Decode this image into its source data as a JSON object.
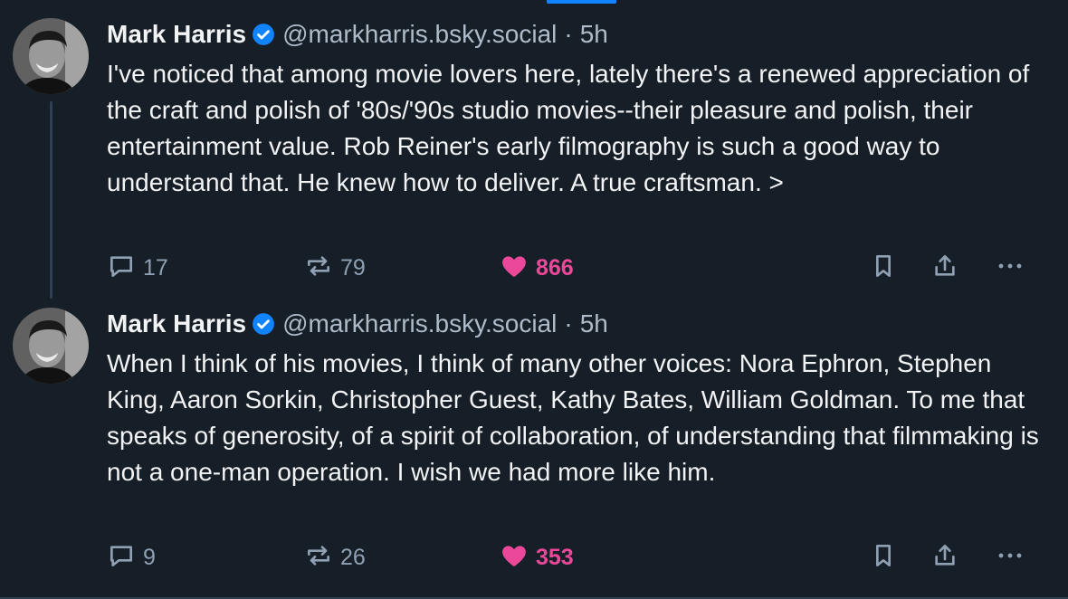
{
  "colors": {
    "background": "#161e27",
    "text": "#f1f3f5",
    "muted": "#aebbc9",
    "like_pink": "#ec4899",
    "verified_blue": "#1083fe"
  },
  "posts": [
    {
      "author_name": "Mark Harris",
      "verified_icon": "verified-check-icon",
      "handle": "@markharris.bsky.social",
      "separator": "·",
      "time": "5h",
      "text": "I've noticed that among movie lovers here, lately there's a renewed appreciation of the craft and polish of '80s/'90s studio movies--their pleasure and polish, their entertainment value. Rob Reiner's early filmography is such a good way to understand that. He knew how to deliver. A true craftsman. >",
      "replies": "17",
      "reposts": "79",
      "likes": "866",
      "liked": true
    },
    {
      "author_name": "Mark Harris",
      "verified_icon": "verified-check-icon",
      "handle": "@markharris.bsky.social",
      "separator": "·",
      "time": "5h",
      "text": "When I think of his movies, I think of many other voices: Nora Ephron, Stephen King, Aaron Sorkin, Christopher Guest, Kathy Bates, William Goldman. To me that speaks of generosity, of a spirit of collaboration, of understanding that filmmaking is not a one-man operation. I wish we had more like him.",
      "replies": "9",
      "reposts": "26",
      "likes": "353",
      "liked": true
    }
  ]
}
